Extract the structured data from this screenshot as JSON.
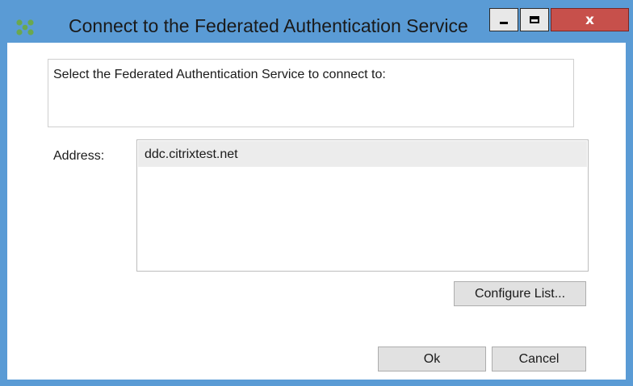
{
  "window": {
    "title": "Connect to the Federated Authentication Service",
    "icon": "citrix-app-icon",
    "controls": {
      "minimize_icon": "minimize-icon",
      "maximize_icon": "maximize-icon",
      "close_label": "x"
    }
  },
  "description": {
    "text": "Select the Federated Authentication Service to connect to:"
  },
  "address": {
    "label": "Address:",
    "items": [
      "ddc.citrixtest.net"
    ]
  },
  "buttons": {
    "configure_label": "Configure List...",
    "ok_label": "Ok",
    "cancel_label": "Cancel"
  },
  "colors": {
    "frame": "#5a9bd5",
    "close": "#c7504b",
    "selection": "#ececec",
    "icon": "#6aa84f"
  }
}
